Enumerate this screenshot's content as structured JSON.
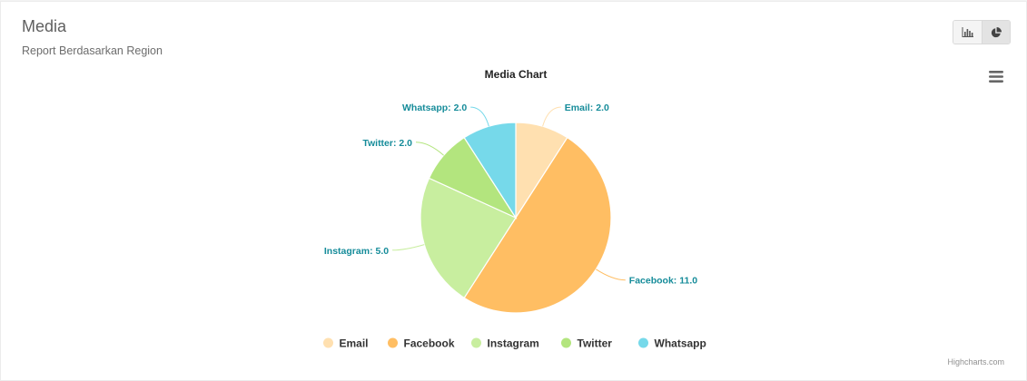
{
  "panel": {
    "title": "Media",
    "subtitle": "Report Berdasarkan Region",
    "credits": "Highcharts.com"
  },
  "toolbar": {
    "view_buttons": [
      {
        "icon": "bar-chart-icon",
        "active": false
      },
      {
        "icon": "pie-chart-icon",
        "active": true
      }
    ],
    "menu_icon": "hamburger-menu-icon"
  },
  "colors": {
    "label": "#168c9a",
    "Email": "#ffe0b0",
    "Facebook": "#ffbe63",
    "Instagram": "#c8ee9f",
    "Twitter": "#b3e57e",
    "Whatsapp": "#76d9ea"
  },
  "chart_data": {
    "type": "pie",
    "title": "Media Chart",
    "categories": [
      "Email",
      "Facebook",
      "Instagram",
      "Twitter",
      "Whatsapp"
    ],
    "values": [
      2.0,
      11.0,
      5.0,
      2.0,
      2.0
    ],
    "data_labels": [
      "Email: 2.0",
      "Facebook: 11.0",
      "Instagram: 5.0",
      "Twitter: 2.0",
      "Whatsapp: 2.0"
    ],
    "legend": {
      "placement": "bottom",
      "items": [
        "Email",
        "Facebook",
        "Instagram",
        "Twitter",
        "Whatsapp"
      ]
    }
  }
}
